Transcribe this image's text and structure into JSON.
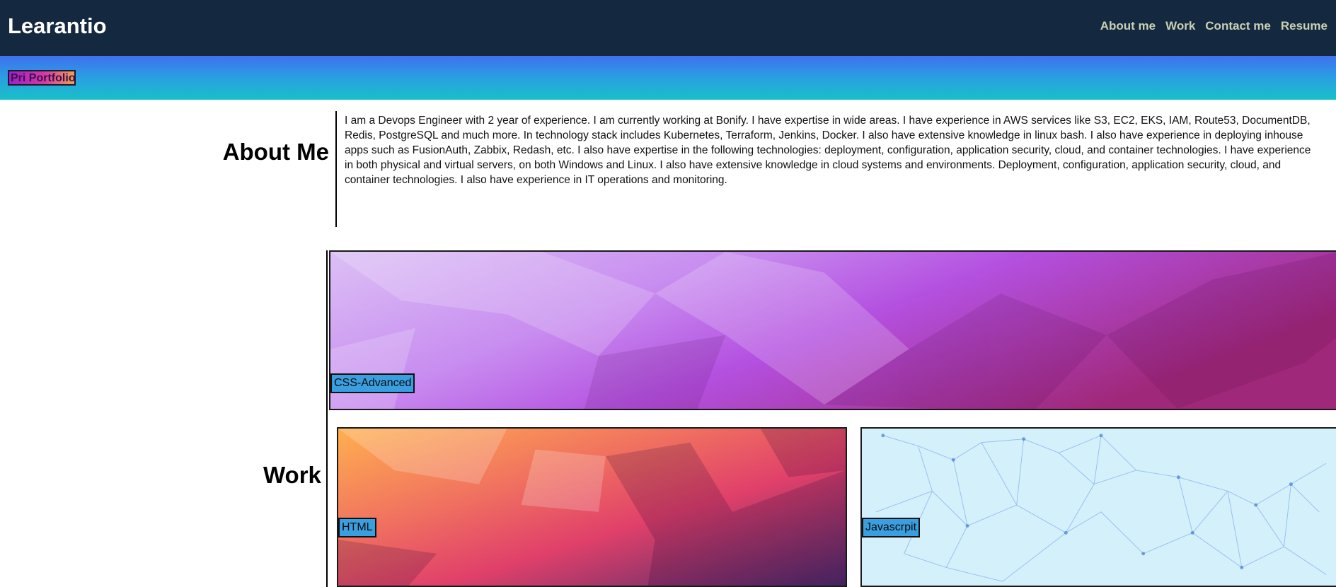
{
  "header": {
    "brand": "Learantio",
    "nav": [
      "About me",
      "Work",
      "Contact me",
      "Resume"
    ]
  },
  "banner": {
    "badge": "Pri Portfolio"
  },
  "about": {
    "heading": "About Me",
    "text": "I am a Devops Engineer with 2 year of experience. I am currently working at Bonify. I have expertise in wide areas. I have experience in AWS services like S3, EC2, EKS, IAM, Route53, DocumentDB, Redis, PostgreSQL and much more. In technology stack includes Kubernetes, Terraform, Jenkins, Docker. I also have extensive knowledge in linux bash. I also have experience in deploying inhouse apps such as FusionAuth, Zabbix, Redash, etc. I also have expertise in the following technologies: deployment, configuration, application security, cloud, and container technologies. I have experience in both physical and virtual servers, on both Windows and Linux. I also have extensive knowledge in cloud systems and environments. Deployment, configuration, application security, cloud, and container technologies. I also have experience in IT operations and monitoring."
  },
  "work": {
    "heading": "Work",
    "cards": [
      {
        "label": "CSS-Advanced"
      },
      {
        "label": "HTML"
      },
      {
        "label": "Javascrpit"
      }
    ]
  },
  "colors": {
    "navbar_bg": "#14283f",
    "nav_link": "#c9d0b6",
    "banner_top": "#4070f0",
    "banner_bottom": "#17c1c9",
    "label_bg": "#3a9fe0"
  }
}
